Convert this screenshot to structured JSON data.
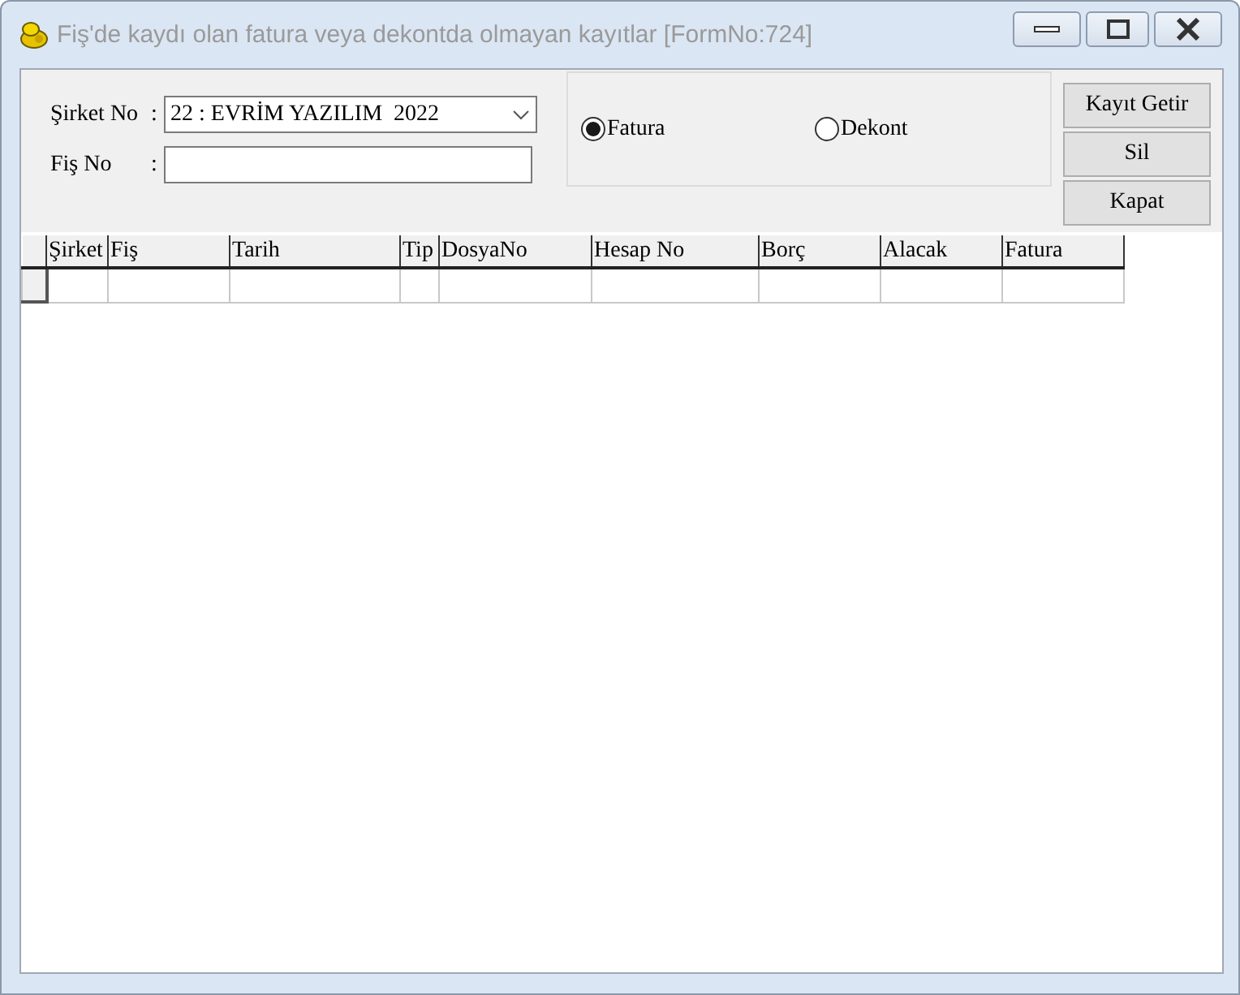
{
  "window": {
    "title": "Fiş'de kaydı olan fatura veya dekontda olmayan kayıtlar [FormNo:724]"
  },
  "form": {
    "company_label": "Şirket No",
    "company_colon": ":",
    "company_value": "22 : EVRİM YAZILIM  2022",
    "receipt_label": "Fiş No",
    "receipt_colon": ":"
  },
  "document_type": [
    {
      "label": "Fatura",
      "selected": true
    },
    {
      "label": "Dekont",
      "selected": false
    }
  ],
  "buttons": [
    "Kayıt Getir",
    "Sil",
    "Kapat"
  ],
  "table": {
    "columns": [
      "Şirket",
      "Fiş",
      "Tarih",
      "Tip",
      "DosyaNo",
      "Hesap No",
      "Borç",
      "Alacak",
      "Fatura"
    ]
  }
}
